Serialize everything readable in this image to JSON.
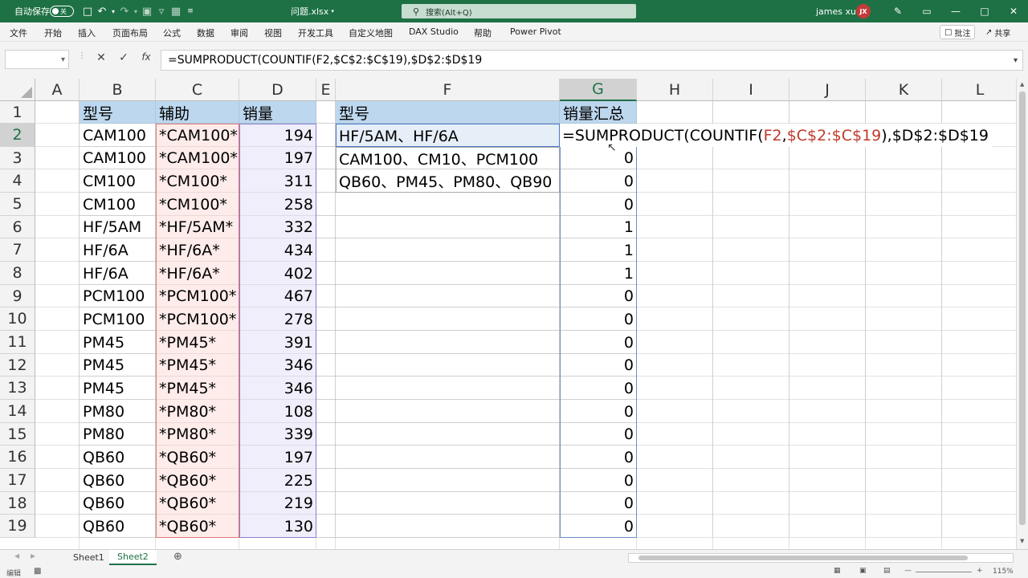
{
  "titlebar": {
    "autosave_label": "自动保存",
    "autosave_state": "关",
    "filename": "问题.xlsx",
    "search_placeholder": "搜索(Alt+Q)",
    "user_name": "james xu",
    "user_initials": "JX"
  },
  "menu": {
    "tabs": [
      "文件",
      "开始",
      "插入",
      "页面布局",
      "公式",
      "数据",
      "审阅",
      "视图",
      "开发工具",
      "自定义地图",
      "DAX Studio",
      "帮助",
      "Power Pivot"
    ],
    "comments_label": "批注",
    "share_label": "共享"
  },
  "formula_bar": {
    "formula": "=SUMPRODUCT(COUNTIF(F2,$C$2:$C$19),$D$2:$D$19"
  },
  "grid": {
    "columns": [
      "A",
      "B",
      "C",
      "D",
      "E",
      "F",
      "G",
      "H",
      "I",
      "J",
      "K",
      "L"
    ],
    "rows": [
      "1",
      "2",
      "3",
      "4",
      "5",
      "6",
      "7",
      "8",
      "9",
      "10",
      "11",
      "12",
      "13",
      "14",
      "15",
      "16",
      "17",
      "18",
      "19"
    ],
    "table1": {
      "headers": [
        "型号",
        "辅助",
        "销量"
      ],
      "rows": [
        [
          "CAM100",
          "*CAM100*",
          "194"
        ],
        [
          "CAM100",
          "*CAM100*",
          "197"
        ],
        [
          "CM100",
          "*CM100*",
          "311"
        ],
        [
          "CM100",
          "*CM100*",
          "258"
        ],
        [
          "HF/5AM",
          "*HF/5AM*",
          "332"
        ],
        [
          "HF/6A",
          "*HF/6A*",
          "434"
        ],
        [
          "HF/6A",
          "*HF/6A*",
          "402"
        ],
        [
          "PCM100",
          "*PCM100*",
          "467"
        ],
        [
          "PCM100",
          "*PCM100*",
          "278"
        ],
        [
          "PM45",
          "*PM45*",
          "391"
        ],
        [
          "PM45",
          "*PM45*",
          "346"
        ],
        [
          "PM45",
          "*PM45*",
          "346"
        ],
        [
          "PM80",
          "*PM80*",
          "108"
        ],
        [
          "PM80",
          "*PM80*",
          "339"
        ],
        [
          "QB60",
          "*QB60*",
          "197"
        ],
        [
          "QB60",
          "*QB60*",
          "225"
        ],
        [
          "QB60",
          "*QB60*",
          "219"
        ],
        [
          "QB60",
          "*QB60*",
          "130"
        ]
      ]
    },
    "table2": {
      "headers": [
        "型号",
        "销量汇总"
      ],
      "f_values": [
        "HF/5AM、HF/6A",
        "CAM100、CM10、PCM100",
        "QB60、PM45、PM80、QB90"
      ],
      "g2_edit": {
        "part1": "=SUMPRODUCT(COUNTIF(",
        "ref1": "F2",
        "part2": ",",
        "ref2": "$C$2:$C$19",
        "part3": "),$D$2:$D$19"
      },
      "g_values": [
        "0",
        "0",
        "0",
        "1",
        "1",
        "1",
        "0",
        "0",
        "0",
        "0",
        "0",
        "0",
        "0",
        "0",
        "0",
        "0",
        "0"
      ]
    }
  },
  "sheets": [
    "Sheet1",
    "Sheet2"
  ],
  "active_sheet": "Sheet2",
  "status": {
    "mode": "编辑",
    "zoom": "115%"
  }
}
